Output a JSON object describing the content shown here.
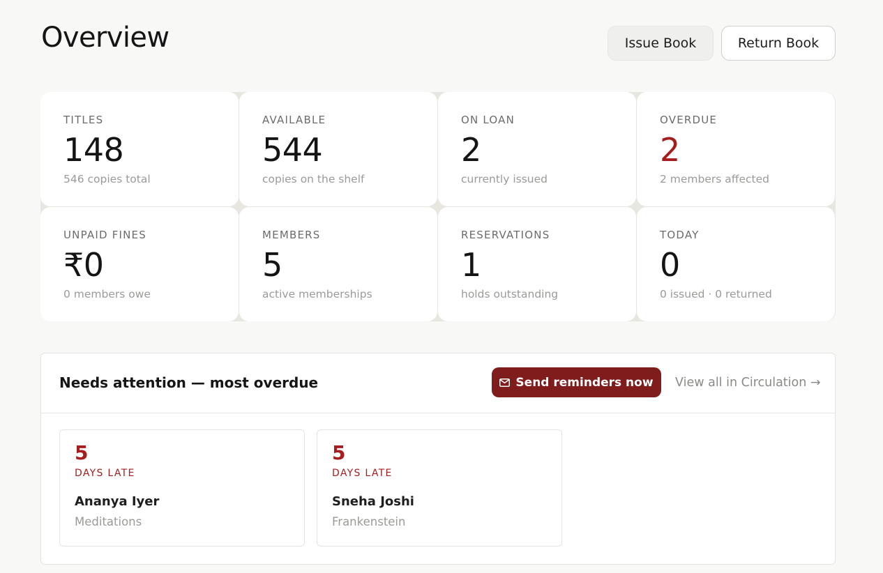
{
  "header": {
    "title": "Overview",
    "issue_label": "Issue Book",
    "return_label": "Return Book"
  },
  "stats": [
    {
      "label": "TITLES",
      "value": "148",
      "sub": "546 copies total"
    },
    {
      "label": "AVAILABLE",
      "value": "544",
      "sub": "copies on the shelf"
    },
    {
      "label": "ON LOAN",
      "value": "2",
      "sub": "currently issued"
    },
    {
      "label": "OVERDUE",
      "value": "2",
      "sub": "2 members affected",
      "color": "#a61d1d"
    },
    {
      "label": "UNPAID FINES",
      "value": "₹0",
      "sub": "0 members owe"
    },
    {
      "label": "MEMBERS",
      "value": "5",
      "sub": "active memberships"
    },
    {
      "label": "RESERVATIONS",
      "value": "1",
      "sub": "holds outstanding"
    },
    {
      "label": "TODAY",
      "value": "0",
      "sub": "0 issued · 0 returned"
    }
  ],
  "attention": {
    "title": "Needs attention — most overdue",
    "remind_label": "Send reminders now",
    "remind_icon": "mail-icon",
    "view_all_label": "View all in Circulation →",
    "accent_color": "#7f1d1d",
    "items": [
      {
        "days": "5",
        "unit": "DAYS LATE",
        "member": "Ananya Iyer",
        "book": "Meditations"
      },
      {
        "days": "5",
        "unit": "DAYS LATE",
        "member": "Sneha Joshi",
        "book": "Frankenstein"
      }
    ]
  }
}
